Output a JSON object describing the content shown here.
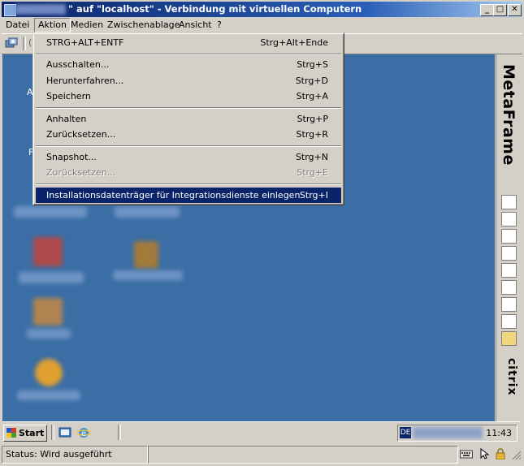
{
  "window": {
    "title": "\" auf \"localhost\" - Verbindung mit virtuellen Computern",
    "controls": {
      "minimize": "_",
      "maximize": "□",
      "close": "✕"
    }
  },
  "menubar": {
    "items": [
      {
        "label": "Datei"
      },
      {
        "label": "Aktion",
        "active": true
      },
      {
        "label": "Medien"
      },
      {
        "label": "Zwischenablage"
      },
      {
        "label": "Ansicht"
      },
      {
        "label": "?"
      }
    ]
  },
  "toolbar": {
    "partial_text": "("
  },
  "action_menu": {
    "items": [
      {
        "label": "STRG+ALT+ENTF",
        "shortcut": "Strg+Alt+Ende",
        "state": "normal"
      },
      {
        "label": "Ausschalten...",
        "shortcut": "Strg+S",
        "state": "normal"
      },
      {
        "label": "Herunterfahren...",
        "shortcut": "Strg+D",
        "state": "normal"
      },
      {
        "label": "Speichern",
        "shortcut": "Strg+A",
        "state": "normal"
      },
      {
        "label": "Anhalten",
        "shortcut": "Strg+P",
        "state": "normal"
      },
      {
        "label": "Zurücksetzen...",
        "shortcut": "Strg+R",
        "state": "normal"
      },
      {
        "label": "Snapshot...",
        "shortcut": "Strg+N",
        "state": "normal"
      },
      {
        "label": "Zurücksetzen...",
        "shortcut": "Strg+E",
        "state": "disabled"
      },
      {
        "label": "Installationsdatenträger für Integrationsdienste einlegen",
        "shortcut": "Strg+I",
        "state": "highlighted"
      }
    ]
  },
  "desktop": {
    "background_color": "#3a6ea5",
    "visible_letters": [
      "A",
      "F"
    ]
  },
  "side_panel": {
    "brand_top": "MetaFrame",
    "brand_bottom": "citrix",
    "icons": [
      "network-icon",
      "search-icon",
      "tree-icon",
      "window-icon",
      "label-icon",
      "close-doc-icon",
      "printer-icon",
      "chart-icon",
      "folder-icon"
    ]
  },
  "taskbar": {
    "start_label": "Start",
    "quicklaunch": [
      "show-desktop-icon",
      "ie-icon"
    ],
    "language": "DE",
    "clock": "11:43"
  },
  "statusbar": {
    "status_text": "Status: Wird ausgeführt",
    "icons": [
      "keyboard-icon",
      "mouse-icon",
      "lock-icon"
    ]
  },
  "colors": {
    "title_gradient_start": "#0a246a",
    "highlight": "#0a246a",
    "chrome": "#d4d0c8"
  }
}
